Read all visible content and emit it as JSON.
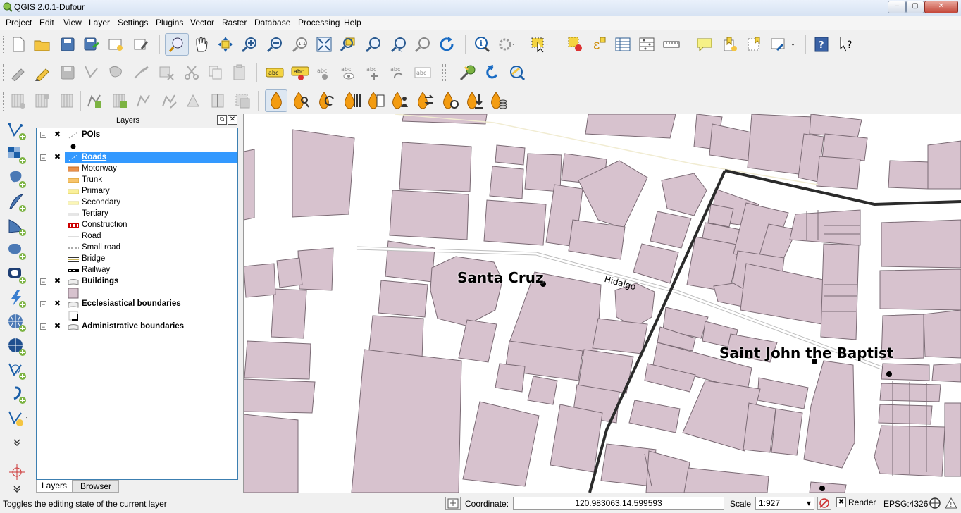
{
  "window": {
    "title": "QGIS 2.0.1-Dufour",
    "min": "‒",
    "max": "▢",
    "close": "✕"
  },
  "menu": [
    "Project",
    "Edit",
    "View",
    "Layer",
    "Settings",
    "Plugins",
    "Vector",
    "Raster",
    "Database",
    "Processing",
    "Help"
  ],
  "layers_panel": {
    "title": "Layers",
    "layers": [
      {
        "name": "POIs",
        "checked": true,
        "bold": true,
        "selected": false,
        "type": "point"
      },
      {
        "name": "Roads",
        "checked": true,
        "bold": true,
        "selected": true,
        "type": "line",
        "classes": [
          {
            "name": "Motorway",
            "swatch": "motorway"
          },
          {
            "name": "Trunk",
            "swatch": "trunk"
          },
          {
            "name": "Primary",
            "swatch": "primary"
          },
          {
            "name": "Secondary",
            "swatch": "secondary"
          },
          {
            "name": "Tertiary",
            "swatch": "tertiary"
          },
          {
            "name": "Construction",
            "swatch": "construction"
          },
          {
            "name": "Road",
            "swatch": "road"
          },
          {
            "name": "Small road",
            "swatch": "small"
          },
          {
            "name": "Bridge",
            "swatch": "bridge"
          },
          {
            "name": "Railway",
            "swatch": "railway"
          }
        ]
      },
      {
        "name": "Buildings",
        "checked": true,
        "bold": true,
        "selected": false,
        "type": "polygon"
      },
      {
        "name": "Ecclesiastical boundaries",
        "checked": true,
        "bold": true,
        "selected": false,
        "type": "polygon"
      },
      {
        "name": "Administrative boundaries",
        "checked": true,
        "bold": true,
        "selected": false,
        "type": "polygon"
      }
    ],
    "tabs": [
      "Layers",
      "Browser"
    ]
  },
  "map": {
    "labels": {
      "santa_cruz": "Santa Cruz",
      "saint_john": "Saint John the Baptist",
      "hidalgo": "Hidalgo"
    },
    "building_fill": "#d7c2ce",
    "building_stroke": "#7a6a74",
    "boundary_color": "#2b2b2b"
  },
  "statusbar": {
    "message": "Toggles the editing state of the current layer",
    "coordinate_label": "Coordinate:",
    "coordinate_value": "120.983063,14.599593",
    "scale_label": "Scale",
    "scale_value": "1:927",
    "render_label": "Render",
    "crs": "EPSG:4326"
  }
}
